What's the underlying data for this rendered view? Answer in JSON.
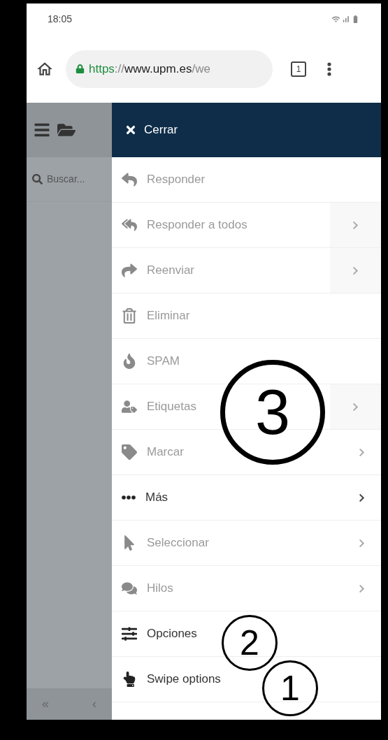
{
  "status_bar": {
    "time": "18:05"
  },
  "browser": {
    "url": {
      "scheme": "https",
      "separator": "://",
      "host": "www.upm.es",
      "path": "/we"
    },
    "tab_count": "1"
  },
  "sidebar": {
    "search": {
      "placeholder": "Buscar..."
    },
    "footer": [
      "«",
      "‹"
    ]
  },
  "menu": {
    "close": "Cerrar",
    "items": [
      {
        "label": "Responder",
        "disabled": true,
        "kind": "plain"
      },
      {
        "label": "Responder a todos",
        "disabled": true,
        "kind": "split"
      },
      {
        "label": "Reenviar",
        "disabled": true,
        "kind": "split"
      },
      {
        "label": "Eliminar",
        "disabled": true,
        "kind": "plain"
      },
      {
        "label": "SPAM",
        "disabled": true,
        "kind": "plain"
      },
      {
        "label": "Etiquetas",
        "disabled": true,
        "kind": "split"
      },
      {
        "label": "Marcar",
        "disabled": true,
        "kind": "submenu"
      },
      {
        "label": "Más",
        "disabled": false,
        "kind": "submenu"
      },
      {
        "label": "Seleccionar",
        "disabled": true,
        "kind": "submenu"
      },
      {
        "label": "Hilos",
        "disabled": true,
        "kind": "submenu"
      },
      {
        "label": "Opciones",
        "disabled": false,
        "kind": "plain"
      },
      {
        "label": "Swipe options",
        "disabled": false,
        "kind": "plain"
      }
    ]
  },
  "annotations": [
    {
      "label": "3",
      "kind": "large"
    },
    {
      "label": "2",
      "kind": "small"
    },
    {
      "label": "1",
      "kind": "small"
    }
  ]
}
